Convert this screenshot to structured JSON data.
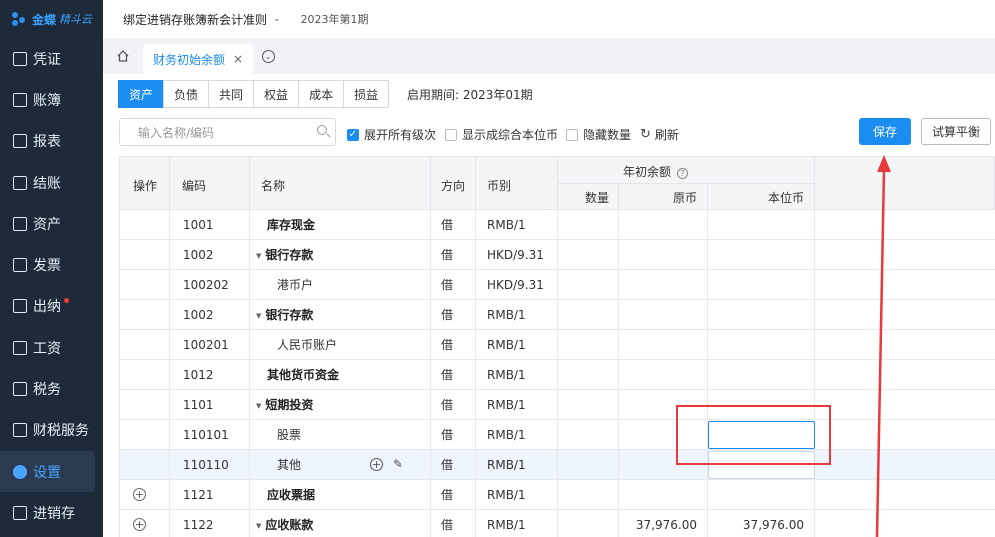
{
  "sidebar": {
    "brand": "金蝶",
    "brand_sub": "精斗云",
    "items": [
      {
        "label": "凭证",
        "icon": "voucher-icon"
      },
      {
        "label": "账簿",
        "icon": "ledger-icon"
      },
      {
        "label": "报表",
        "icon": "report-icon"
      },
      {
        "label": "结账",
        "icon": "close-books-icon"
      },
      {
        "label": "资产",
        "icon": "asset-icon"
      },
      {
        "label": "发票",
        "icon": "invoice-icon"
      },
      {
        "label": "出纳",
        "icon": "cashier-icon"
      },
      {
        "label": "工资",
        "icon": "salary-icon"
      },
      {
        "label": "税务",
        "icon": "tax-icon"
      },
      {
        "label": "财税服务",
        "icon": "tax-service-icon"
      },
      {
        "label": "设置",
        "icon": "settings-icon"
      },
      {
        "label": "进销存",
        "icon": "inventory-icon"
      }
    ]
  },
  "topbar": {
    "account_book": "绑定进销存账簿新会计准则",
    "period": "2023年第1期"
  },
  "tabs": {
    "active_tab": "财务初始余额"
  },
  "segments": [
    "资产",
    "负债",
    "共同",
    "权益",
    "成本",
    "损益"
  ],
  "start_period": "启用期间: 2023年01期",
  "toolbar": {
    "search_placeholder": "输入名称/编码",
    "expand_all": "展开所有级次",
    "show_combined": "显示成综合本位币",
    "hide_quantity": "隐藏数量",
    "refresh": "刷新",
    "save": "保存",
    "trial_balance": "试算平衡"
  },
  "table": {
    "headers": {
      "action": "操作",
      "code": "编码",
      "name": "名称",
      "direction": "方向",
      "currency": "币别",
      "opening_balance": "年初余额",
      "quantity": "数量",
      "original": "原币",
      "local": "本位币"
    },
    "rows": [
      {
        "code": "1001",
        "name": "库存现金",
        "bold": true,
        "level": 1,
        "expand": false,
        "dir": "借",
        "cur": "RMB/1",
        "orig": "",
        "local": ""
      },
      {
        "code": "1002",
        "name": "银行存款",
        "bold": true,
        "level": 1,
        "expand": true,
        "dir": "借",
        "cur": "HKD/9.31",
        "orig": "",
        "local": ""
      },
      {
        "code": "100202",
        "name": "港币户",
        "bold": false,
        "level": 2,
        "expand": false,
        "dir": "借",
        "cur": "HKD/9.31",
        "orig": "",
        "local": ""
      },
      {
        "code": "1002",
        "name": "银行存款",
        "bold": true,
        "level": 1,
        "expand": true,
        "dir": "借",
        "cur": "RMB/1",
        "orig": "",
        "local": ""
      },
      {
        "code": "100201",
        "name": "人民币账户",
        "bold": false,
        "level": 2,
        "expand": false,
        "dir": "借",
        "cur": "RMB/1",
        "orig": "",
        "local": ""
      },
      {
        "code": "1012",
        "name": "其他货币资金",
        "bold": true,
        "level": 1,
        "expand": false,
        "dir": "借",
        "cur": "RMB/1",
        "orig": "",
        "local": ""
      },
      {
        "code": "1101",
        "name": "短期投资",
        "bold": true,
        "level": 1,
        "expand": true,
        "dir": "借",
        "cur": "RMB/1",
        "orig": "",
        "local": ""
      },
      {
        "code": "110101",
        "name": "股票",
        "bold": false,
        "level": 2,
        "expand": false,
        "dir": "借",
        "cur": "RMB/1",
        "orig": "",
        "local": ""
      },
      {
        "code": "110110",
        "name": "其他",
        "bold": false,
        "level": 2,
        "expand": false,
        "dir": "借",
        "cur": "RMB/1",
        "orig": "",
        "local": ""
      },
      {
        "code": "1121",
        "name": "应收票据",
        "bold": true,
        "level": 1,
        "expand": false,
        "dir": "借",
        "cur": "RMB/1",
        "orig": "",
        "local": ""
      },
      {
        "code": "1122",
        "name": "应收账款",
        "bold": true,
        "level": 1,
        "expand": true,
        "dir": "借",
        "cur": "RMB/1",
        "orig": "37,976.00",
        "local": "37,976.00"
      }
    ]
  },
  "colors": {
    "sidebar_bg": "#1d2a3a",
    "accent": "#1b8cf0",
    "annotation": "#e8393f"
  }
}
